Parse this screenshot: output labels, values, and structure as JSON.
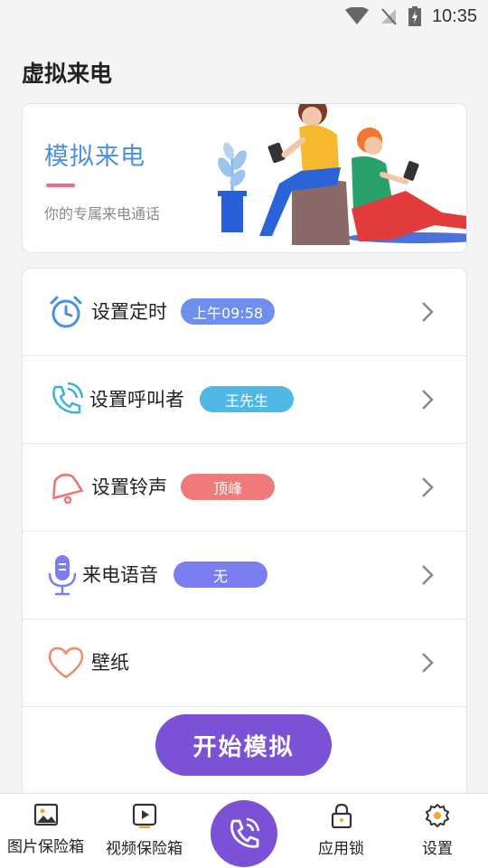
{
  "status_bar": {
    "time": "10:35"
  },
  "header": {
    "title": "虚拟来电"
  },
  "banner": {
    "title": "模拟来电",
    "subtitle": "你的专属来电通话",
    "accent": "#f06a8c",
    "title_color": "#4a90e2"
  },
  "menu": {
    "items": [
      {
        "label": "设置定时",
        "badge": "上午09:58",
        "badge_color": "#6f8ff0",
        "icon": "alarm-clock-icon"
      },
      {
        "label": "设置呼叫者",
        "badge": "王先生",
        "badge_color": "#4fb8e6",
        "icon": "phone-call-icon"
      },
      {
        "label": "设置铃声",
        "badge": "顶峰",
        "badge_color": "#f07a7a",
        "icon": "bell-icon"
      },
      {
        "label": "来电语音",
        "badge": "无",
        "badge_color": "#7a7ef0",
        "icon": "microphone-icon"
      },
      {
        "label": "壁纸",
        "badge": "",
        "badge_color": "",
        "icon": "heart-icon"
      }
    ]
  },
  "start_button": {
    "label": "开始模拟",
    "color": "#7b52d6"
  },
  "bottom_nav": {
    "items": [
      {
        "label": "图片保险箱",
        "icon": "image-icon"
      },
      {
        "label": "视频保险箱",
        "icon": "video-icon"
      },
      {
        "label": "",
        "icon": "phone-call-icon"
      },
      {
        "label": "应用锁",
        "icon": "lock-icon"
      },
      {
        "label": "设置",
        "icon": "gear-icon"
      }
    ]
  }
}
